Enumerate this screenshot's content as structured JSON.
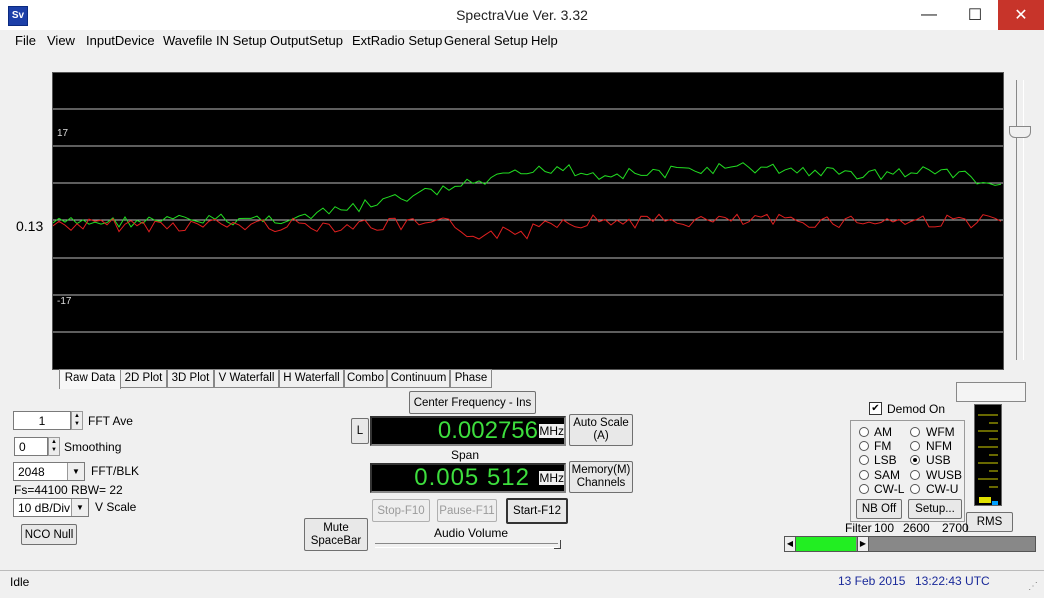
{
  "window": {
    "title": "SpectraVue Ver. 3.32",
    "icon_text": "Sv",
    "minimize": "—",
    "maximize": "☐",
    "close": "✕"
  },
  "menu": [
    "File",
    "View",
    "InputDevice",
    "Wavefile IN Setup",
    "OutputSetup",
    "ExtRadio Setup",
    "General Setup",
    "Help"
  ],
  "plot": {
    "left_value": "0.13",
    "label_top": "17",
    "label_bottom": "-17"
  },
  "tabs": [
    "Raw Data",
    "2D Plot",
    "3D Plot",
    "V Waterfall",
    "H Waterfall",
    "Combo",
    "Continuum",
    "Phase"
  ],
  "controls": {
    "fft_ave_value": "1",
    "fft_ave_label": "FFT Ave",
    "smoothing_value": "0",
    "smoothing_label": "Smoothing",
    "fft_blk_value": "2048",
    "fft_blk_label": "FFT/BLK",
    "fs_rbw": "Fs=44100 RBW=  22",
    "vscale_value": "10 dB/Div",
    "vscale_label": "V Scale",
    "nco_null": "NCO Null",
    "mute_line1": "Mute",
    "mute_line2": "SpaceBar"
  },
  "center": {
    "center_freq_button": "Center Frequency - Ins",
    "l_button": "L",
    "center_value": "0.002756",
    "center_unit": "MHz",
    "auto_scale_line1": "Auto Scale",
    "auto_scale_line2": "(A)",
    "span_label": "Span",
    "span_value": "0.005 512",
    "span_unit": "MHz",
    "memory_line1": "Memory(M)",
    "memory_line2": "Channels",
    "stop": "Stop-F10",
    "pause": "Pause-F11",
    "start": "Start-F12",
    "audio_volume": "Audio Volume"
  },
  "demod": {
    "demod_on": "Demod On",
    "modes_left": [
      "AM",
      "FM",
      "LSB",
      "SAM",
      "CW-L"
    ],
    "modes_right": [
      "WFM",
      "NFM",
      "USB",
      "WUSB",
      "CW-U"
    ],
    "selected": "USB",
    "nb_off": "NB Off",
    "setup": "Setup...",
    "rms": "RMS",
    "filter_label": "Filter",
    "filter_values": [
      "100",
      "2600",
      "2700"
    ]
  },
  "status": {
    "left": "Idle",
    "date": "13 Feb 2015",
    "time": "13:22:43 UTC"
  },
  "series_colors": {
    "green": "#22dd22",
    "red": "#e02020"
  }
}
